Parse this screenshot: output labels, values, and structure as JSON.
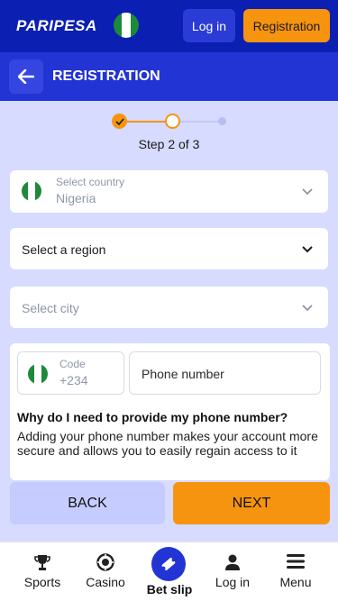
{
  "header": {
    "logo_text": "PARIPESA",
    "login_label": "Log in",
    "registration_label": "Registration"
  },
  "titlebar": {
    "title": "REGISTRATION"
  },
  "stepper": {
    "label": "Step 2 of 3",
    "current_step": 2,
    "total_steps": 3
  },
  "form": {
    "country": {
      "label": "Select country",
      "value": "Nigeria"
    },
    "region": {
      "placeholder": "Select a region"
    },
    "city": {
      "placeholder": "Select city"
    },
    "phone": {
      "code_label": "Code",
      "code_value": "+234",
      "placeholder": "Phone number"
    },
    "why_title": "Why do I need to provide my phone number?",
    "why_text": "Adding your phone number makes your account more secure and allows you to easily regain access to it"
  },
  "actions": {
    "back_label": "BACK",
    "next_label": "NEXT"
  },
  "bottom_nav": {
    "items": [
      {
        "label": "Sports",
        "icon": "trophy-icon"
      },
      {
        "label": "Casino",
        "icon": "casino-chip-icon"
      },
      {
        "label": "Bet slip",
        "icon": "ticket-icon"
      },
      {
        "label": "Log in",
        "icon": "user-icon"
      },
      {
        "label": "Menu",
        "icon": "hamburger-icon"
      }
    ]
  },
  "colors": {
    "header_bg": "#0b1fb3",
    "titlebar_bg": "#2234d4",
    "accent": "#f7940f",
    "page_bg": "#d6dbff",
    "back_button_bg": "#c6ccff",
    "flag_green": "#1d8a3a"
  }
}
